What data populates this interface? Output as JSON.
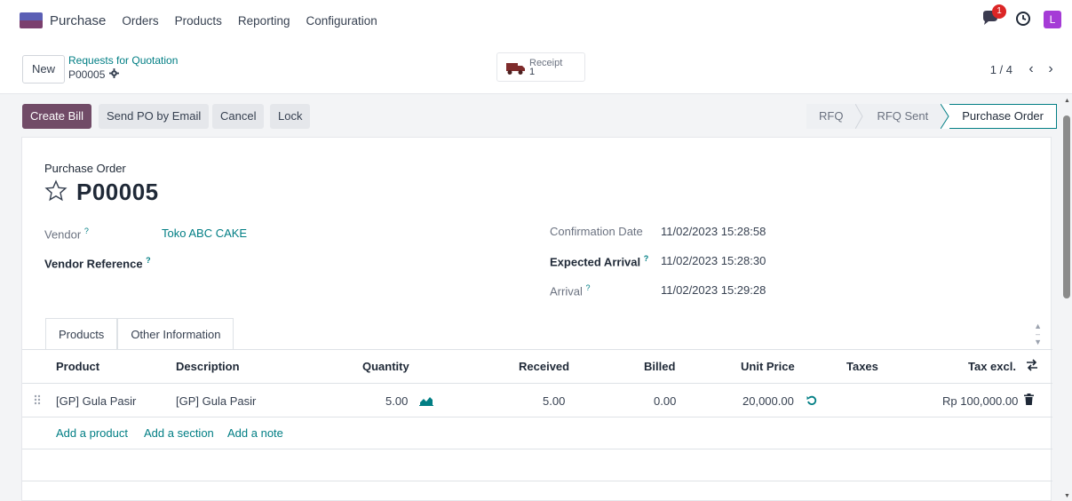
{
  "navbar": {
    "app_name": "Purchase",
    "menu": [
      "Orders",
      "Products",
      "Reporting",
      "Configuration"
    ],
    "chat_badge": "1",
    "avatar_letter": "L",
    "avatar_color": "#a53bd6"
  },
  "control": {
    "new_label": "New",
    "breadcrumb_parent": "Requests for Quotation",
    "breadcrumb_current": "P00005",
    "smart_button": {
      "label": "Receipt",
      "count": "1",
      "icon": "truck-icon"
    },
    "pager": "1 / 4"
  },
  "actions": {
    "create_bill": "Create Bill",
    "send_po": "Send PO by Email",
    "cancel": "Cancel",
    "lock": "Lock"
  },
  "statusbar": {
    "stages": [
      "RFQ",
      "RFQ Sent",
      "Purchase Order"
    ],
    "active": "Purchase Order"
  },
  "form": {
    "subtitle": "Purchase Order",
    "name": "P00005",
    "vendor_label": "Vendor",
    "vendor_value": "Toko ABC CAKE",
    "vendor_ref_label": "Vendor Reference",
    "confirmation_label": "Confirmation Date",
    "confirmation_value": "11/02/2023 15:28:58",
    "expected_label": "Expected Arrival",
    "expected_value": "11/02/2023 15:28:30",
    "arrival_label": "Arrival",
    "arrival_value": "11/02/2023 15:29:28"
  },
  "tabs": [
    "Products",
    "Other Information"
  ],
  "table": {
    "columns": [
      "Product",
      "Description",
      "Quantity",
      "Received",
      "Billed",
      "Unit Price",
      "Taxes",
      "Tax excl."
    ],
    "rows": [
      {
        "product": "[GP] Gula Pasir",
        "description": "[GP] Gula Pasir",
        "quantity": "5.00",
        "received": "5.00",
        "billed": "0.00",
        "unit_price": "20,000.00",
        "taxes": "",
        "subtotal": "Rp 100,000.00"
      }
    ],
    "add_links": [
      "Add a product",
      "Add a section",
      "Add a note"
    ]
  },
  "colors": {
    "primary": "#714b67",
    "link": "#017e84",
    "badge": "#dc2626"
  }
}
